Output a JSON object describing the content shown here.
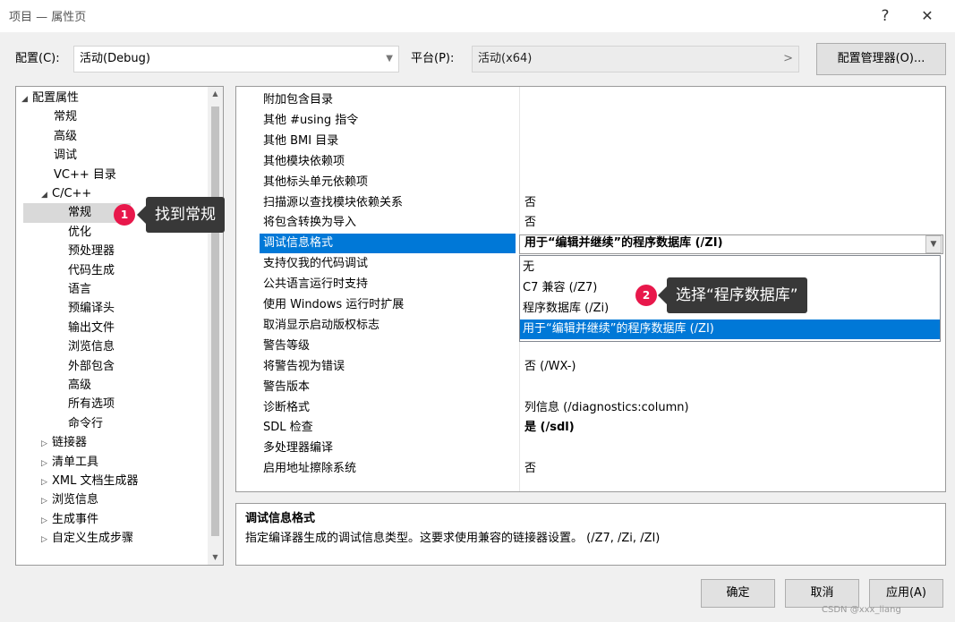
{
  "window": {
    "title": "项目 — 属性页",
    "help": "?",
    "close": "✕"
  },
  "toolbar": {
    "config_label": "配置(C):",
    "config_value": "活动(Debug)",
    "platform_label": "平台(P):",
    "platform_value": "活动(x64)",
    "config_manager": "配置管理器(O)..."
  },
  "tree": {
    "items": [
      {
        "label": "配置属性",
        "expander": "◢"
      },
      {
        "label": "常规"
      },
      {
        "label": "高级"
      },
      {
        "label": "调试"
      },
      {
        "label": "VC++ 目录"
      },
      {
        "label": "C/C++",
        "expander": "◢"
      },
      {
        "label": "常规",
        "selected": true
      },
      {
        "label": "优化"
      },
      {
        "label": "预处理器"
      },
      {
        "label": "代码生成"
      },
      {
        "label": "语言"
      },
      {
        "label": "预编译头"
      },
      {
        "label": "输出文件"
      },
      {
        "label": "浏览信息"
      },
      {
        "label": "外部包含"
      },
      {
        "label": "高级"
      },
      {
        "label": "所有选项"
      },
      {
        "label": "命令行"
      },
      {
        "label": "链接器",
        "expander": "▷"
      },
      {
        "label": "清单工具",
        "expander": "▷"
      },
      {
        "label": "XML 文档生成器",
        "expander": "▷"
      },
      {
        "label": "浏览信息",
        "expander": "▷"
      },
      {
        "label": "生成事件",
        "expander": "▷"
      },
      {
        "label": "自定义生成步骤",
        "expander": "▷"
      }
    ]
  },
  "grid": {
    "rows": [
      {
        "name": "附加包含目录",
        "value": ""
      },
      {
        "name": "其他 #using 指令",
        "value": ""
      },
      {
        "name": "其他 BMI 目录",
        "value": ""
      },
      {
        "name": "其他模块依赖项",
        "value": ""
      },
      {
        "name": "其他标头单元依赖项",
        "value": ""
      },
      {
        "name": "扫描源以查找模块依赖关系",
        "value": "否"
      },
      {
        "name": "将包含转换为导入",
        "value": "否"
      },
      {
        "name": "调试信息格式",
        "value": "用于“编辑并继续”的程序数据库 (/ZI)",
        "bold": true,
        "selected": true
      },
      {
        "name": "支持仅我的代码调试",
        "value": ""
      },
      {
        "name": "公共语言运行时支持",
        "value": ""
      },
      {
        "name": "使用 Windows 运行时扩展",
        "value": ""
      },
      {
        "name": "取消显示启动版权标志",
        "value": ""
      },
      {
        "name": "警告等级",
        "value": ""
      },
      {
        "name": "将警告视为错误",
        "value": "否 (/WX-)"
      },
      {
        "name": "警告版本",
        "value": ""
      },
      {
        "name": "诊断格式",
        "value": "列信息 (/diagnostics:column)"
      },
      {
        "name": "SDL 检查",
        "value": "是 (/sdl)",
        "bold": true
      },
      {
        "name": "多处理器编译",
        "value": ""
      },
      {
        "name": "启用地址擦除系统",
        "value": "否"
      }
    ]
  },
  "dropdown": {
    "options": [
      "无",
      "C7 兼容 (/Z7)",
      "程序数据库 (/Zi)",
      "用于“编辑并继续”的程序数据库 (/ZI)"
    ],
    "highlighted": 3
  },
  "description": {
    "title": "调试信息格式",
    "text": "指定编译器生成的调试信息类型。这要求使用兼容的链接器设置。  (/Z7, /Zi, /ZI)"
  },
  "annotations": [
    {
      "badge": "1",
      "text": "找到常规"
    },
    {
      "badge": "2",
      "text": "选择“程序数据库”"
    }
  ],
  "buttons": {
    "ok": "确定",
    "cancel": "取消",
    "apply": "应用(A)"
  },
  "watermark": "CSDN @xxx_liang",
  "colors": {
    "selection": "#0078d7",
    "badge": "#e8184b",
    "callout": "#383838"
  }
}
